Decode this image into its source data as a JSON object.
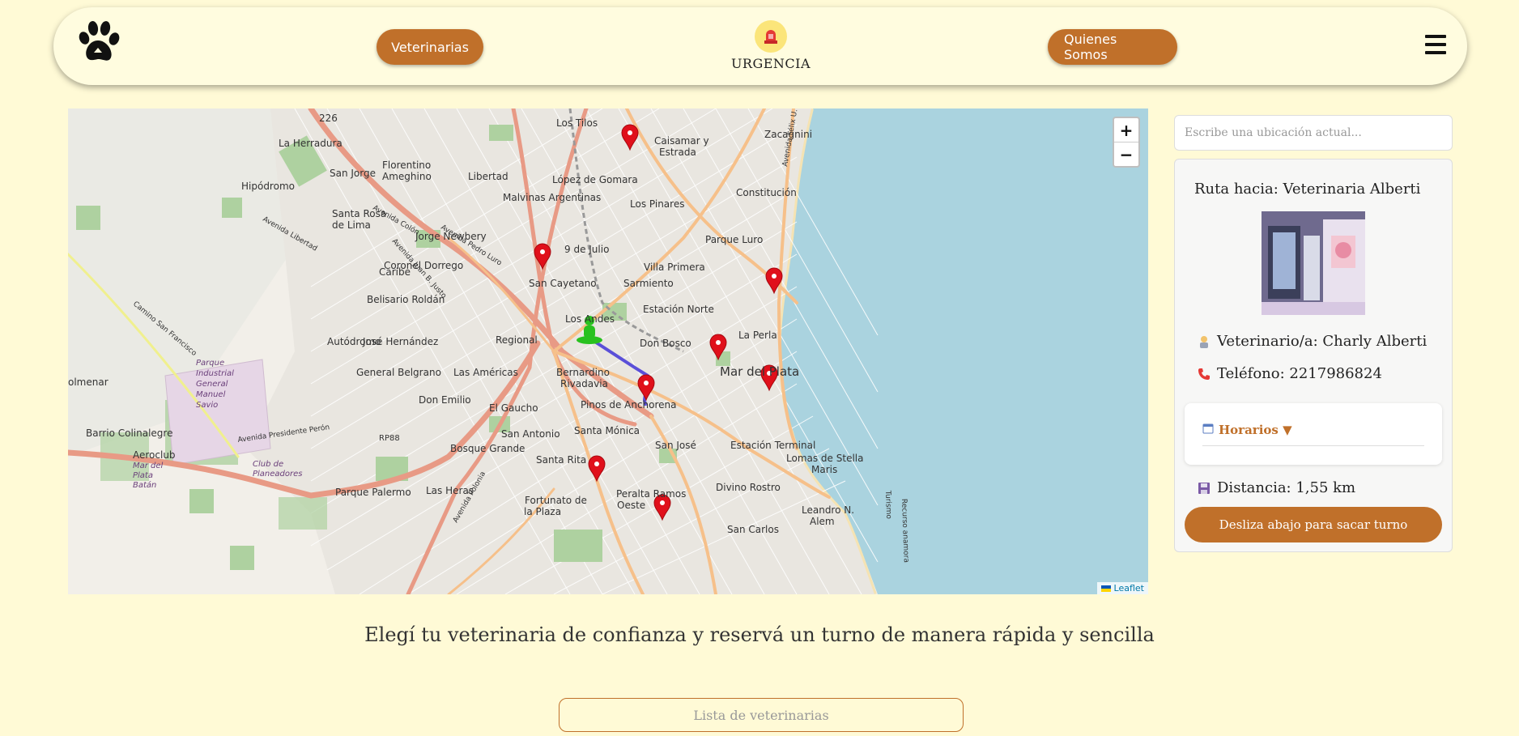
{
  "header": {
    "vets_label": "Veterinarias",
    "urgency_label": "URGENCIA",
    "about_label": "Quienes Somos",
    "logo_icon": "paw-icon",
    "menu_icon": "hamburger-menu-icon",
    "urgency_icon": "siren-icon"
  },
  "map": {
    "zoom_in": "+",
    "zoom_out": "−",
    "attribution": "Leaflet",
    "labels": [
      "Los Tilos",
      "Caisamar y",
      "Estrada",
      "Zacagnini",
      "La Herradura",
      "Florentino",
      "Ameghino",
      "San Jorge",
      "Libertad",
      "López de Gomara",
      "Hipódromo",
      "Malvinas Argentinas",
      "Los Pinares",
      "Constitución",
      "Santa Rosa",
      "de Lima",
      "Jorge Newbery",
      "9 de Julio",
      "Parque Luro",
      "Coronel Dorrego",
      "Villa Primera",
      "Caribe",
      "San Cayetano",
      "Sarmiento",
      "Belisario Roldán",
      "Estación Norte",
      "Los Andes",
      "La Perla",
      "Autódromo",
      "José Hernández",
      "Regional",
      "Don Bosco",
      "Parque",
      "Industrial",
      "General",
      "Manuel",
      "Savio",
      "General Belgrano",
      "Las Américas",
      "Bernardino",
      "Rivadavia",
      "Mar del Plata",
      "olmenar",
      "Don Emilio",
      "El Gaucho",
      "Pinos de Anchorena",
      "Barrio Colinalegre",
      "San Antonio",
      "Santa Mónica",
      "Bosque Grande",
      "San José",
      "Estación Terminal",
      "Santa Rita",
      "Lomas de Stella",
      "Maris",
      "Aeroclub",
      "Mar del",
      "Plata",
      "Batán",
      "Club de",
      "Planeadores",
      "Parque Palermo",
      "Las Heras",
      "Peralta Ramos",
      "Oeste",
      "Divino Rostro",
      "Fortunato de",
      "la Plaza",
      "Leandro N.",
      "Alem",
      "San Carlos",
      "RP88",
      "Camino San Francisco",
      "Avenida Presidente Perón",
      "Avenida Colón",
      "Avenida Pedro Luro",
      "Avenida Libertad",
      "Avenida Juan B. Justo",
      "Avenida Félix U. Camet",
      "Avenida Polonia",
      "Turismo",
      "Recurso anamora",
      "226"
    ]
  },
  "search": {
    "placeholder": "Escribe una ubicación actual..."
  },
  "route": {
    "title": "Ruta hacia: Veterinaria Alberti",
    "vet_label": "Veterinario/a: Charly Alberti",
    "phone_label": "Teléfono: 2217986824",
    "hours_label": "Horarios ▼",
    "distance_label": "Distancia: 1,55 km",
    "turn_button": "Desliza abajo para sacar turno",
    "vet_icon": "doctor-icon",
    "phone_icon": "phone-icon",
    "hours_icon": "calendar-icon",
    "distance_icon": "floppy-disk-icon"
  },
  "main": {
    "tagline": "Elegí tu veterinaria de confianza y reservá un turno de manera rápida y sencilla",
    "list_placeholder": "Lista de veterinarias"
  },
  "colors": {
    "background": "#fffad6",
    "accent": "#c0702a",
    "marker": "#e0101b",
    "route": "#5a4fd8",
    "sea": "#aad3df"
  }
}
